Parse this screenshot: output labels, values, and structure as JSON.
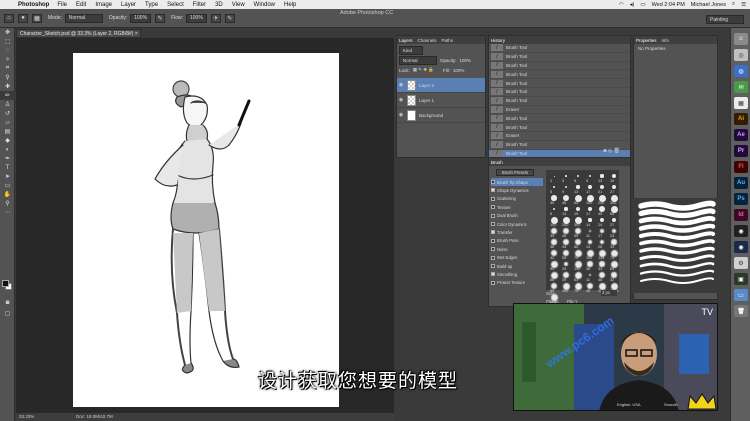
{
  "menubar": {
    "app_name": "Photoshop",
    "items": [
      "File",
      "Edit",
      "Image",
      "Layer",
      "Type",
      "Select",
      "Filter",
      "3D",
      "View",
      "Window",
      "Help"
    ],
    "datetime": "Wed 2:04 PM",
    "user": "Michael Jones"
  },
  "window_title": "Adobe Photoshop CC",
  "options": {
    "mode_label": "Mode:",
    "mode_value": "Normal",
    "opacity_label": "Opacity:",
    "opacity_value": "100%",
    "flow_label": "Flow:",
    "flow_value": "100%",
    "workspace": "Painting"
  },
  "document": {
    "tab_label": "Character_Sketch.psd @ 33.3% (Layer 2, RGB/8#) ×",
    "zoom": "33.33%",
    "doc_info": "Doc: 18.0M/42.7M"
  },
  "layers_panel": {
    "tabs": [
      "Layers",
      "Channels",
      "Paths"
    ],
    "kind_label": "Kind",
    "blend_mode": "Normal",
    "opacity_label": "Opacity:",
    "opacity_value": "100%",
    "lock_label": "Lock:",
    "fill_label": "Fill:",
    "fill_value": "100%",
    "layers": [
      {
        "name": "Layer 2",
        "selected": true
      },
      {
        "name": "Layer 1",
        "selected": false
      },
      {
        "name": "Background",
        "selected": false
      }
    ]
  },
  "history_panel": {
    "title": "History",
    "items": [
      "Brush Tool",
      "Brush Tool",
      "Brush Tool",
      "Brush Tool",
      "Brush Tool",
      "Brush Tool",
      "Brush Tool",
      "Eraser",
      "Brush Tool",
      "Brush Tool",
      "Eraser",
      "Brush Tool",
      "Brush Tool"
    ]
  },
  "brush_panel": {
    "title": "Brush",
    "presets_button": "Brush Presets",
    "options": [
      {
        "label": "Brush Tip Shape",
        "checked": false,
        "selected": true
      },
      {
        "label": "Shape Dynamics",
        "checked": true
      },
      {
        "label": "Scattering",
        "checked": false
      },
      {
        "label": "Texture",
        "checked": false
      },
      {
        "label": "Dual Brush",
        "checked": false
      },
      {
        "label": "Color Dynamics",
        "checked": false
      },
      {
        "label": "Transfer",
        "checked": true
      },
      {
        "label": "Brush Pose",
        "checked": false
      },
      {
        "label": "Noise",
        "checked": false
      },
      {
        "label": "Wet Edges",
        "checked": false
      },
      {
        "label": "Build-up",
        "checked": false
      },
      {
        "label": "Smoothing",
        "checked": true
      },
      {
        "label": "Protect Texture",
        "checked": false
      }
    ],
    "tip_sizes": [
      "1",
      "3",
      "5",
      "9",
      "13",
      "19",
      "5",
      "9",
      "13",
      "17",
      "21",
      "27",
      "35",
      "45",
      "65",
      "100",
      "200",
      "300",
      "9",
      "13",
      "19",
      "17",
      "45",
      "65",
      "100",
      "200",
      "300",
      "14",
      "24",
      "27",
      "39",
      "46",
      "59",
      "11",
      "17",
      "23",
      "36",
      "44",
      "60",
      "14",
      "26",
      "33",
      "42",
      "55",
      "70",
      "112",
      "134",
      "74",
      "95",
      "29",
      "192",
      "36",
      "33",
      "63",
      "66",
      "39",
      "63",
      "11",
      "48",
      "32",
      "55",
      "100",
      "75",
      "45",
      "1106",
      "1499",
      "1569"
    ],
    "size_label": "Size",
    "size_value": "3 px",
    "flip_x": "Flip X",
    "flip_y": "Flip Y"
  },
  "properties_panel": {
    "tabs": [
      "Properties",
      "Info"
    ],
    "message": "No Properties"
  },
  "video": {
    "locale": "English: USA",
    "preset": "Smooth",
    "corner_text": "TV"
  },
  "subtitle": "设计获取您想要的模型",
  "watermark": "www.pc6.com"
}
